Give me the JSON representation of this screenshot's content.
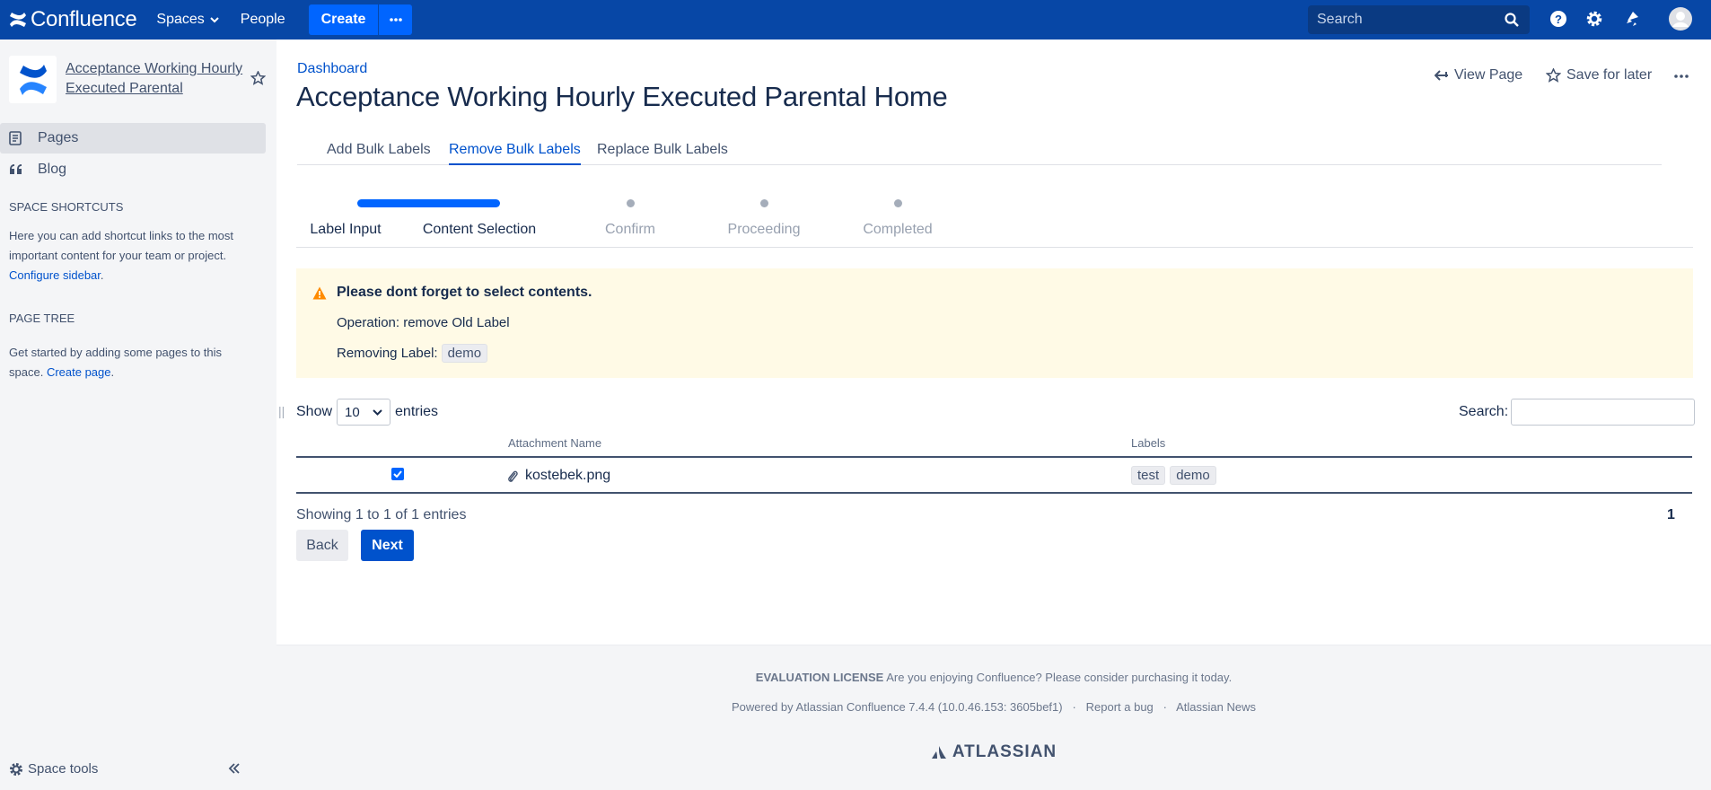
{
  "topbar": {
    "brand": "Confluence",
    "spaces_label": "Spaces",
    "people_label": "People",
    "create_label": "Create",
    "search_placeholder": "Search"
  },
  "sidebar": {
    "space_name": "Acceptance Working Hourly Executed Parental",
    "nav": [
      {
        "label": "Pages",
        "icon": "pages-icon",
        "active": true
      },
      {
        "label": "Blog",
        "icon": "quote-icon",
        "active": false
      }
    ],
    "shortcuts_heading": "SPACE SHORTCUTS",
    "shortcuts_text": "Here you can add shortcut links to the most important content for your team or project.",
    "configure_link": "Configure sidebar",
    "page_tree_heading": "PAGE TREE",
    "page_tree_text": "Get started by adding some pages to this space.",
    "create_page_link": "Create page",
    "space_tools": "Space tools"
  },
  "page": {
    "breadcrumb": "Dashboard",
    "title": "Acceptance Working Hourly Executed Parental Home",
    "view_page": "View Page",
    "save_for_later": "Save for later"
  },
  "tabs": [
    {
      "label": "Add Bulk Labels",
      "active": false
    },
    {
      "label": "Remove Bulk Labels",
      "active": true
    },
    {
      "label": "Replace Bulk Labels",
      "active": false
    }
  ],
  "steps": [
    {
      "label": "Label Input"
    },
    {
      "label": "Content Selection"
    },
    {
      "label": "Confirm"
    },
    {
      "label": "Proceeding"
    },
    {
      "label": "Completed"
    }
  ],
  "warning": {
    "title": "Please dont forget to select contents.",
    "operation": "Operation: remove Old Label",
    "removing_label": "Removing Label:",
    "label_value": "demo"
  },
  "table_controls": {
    "show": "Show",
    "entries_value": "10",
    "entries": "entries",
    "search": "Search:"
  },
  "table": {
    "headers": [
      "Attachment Name",
      "Labels"
    ],
    "rows": [
      {
        "checked": true,
        "name": "kostebek.png",
        "labels": [
          "test",
          "demo"
        ]
      }
    ]
  },
  "pagination": {
    "showing": "Showing 1 to 1 of 1 entries",
    "page": "1",
    "back": "Back",
    "next": "Next"
  },
  "footer": {
    "license_bold": "EVALUATION LICENSE",
    "license_text": "Are you enjoying Confluence? Please consider purchasing it today.",
    "powered": "Powered by Atlassian Confluence 7.4.4 (10.0.46.153: 3605bef1)",
    "report": "Report a bug",
    "news": "Atlassian News",
    "atlassian": "ATLASSIAN"
  },
  "colors": {
    "topbar": "#0747a6",
    "primary": "#0052cc",
    "progress": "#0065ff",
    "warning_bg": "#fffae6",
    "warning_icon": "#ff8b00"
  }
}
